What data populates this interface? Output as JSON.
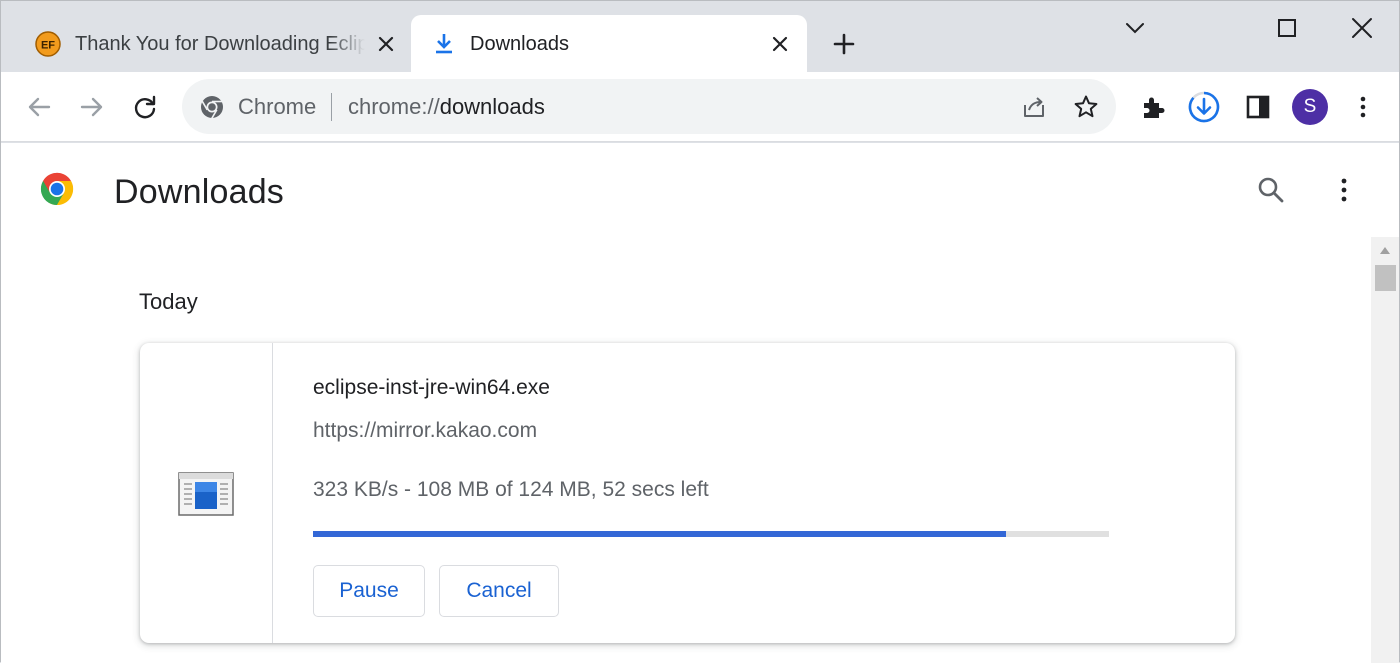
{
  "tabs": [
    {
      "title": "Thank You for Downloading Eclipse",
      "favicon_text": "EF",
      "active": false
    },
    {
      "title": "Downloads",
      "active": true
    }
  ],
  "omnibox": {
    "chip": "Chrome",
    "url_scheme": "chrome://",
    "url_host": "downloads"
  },
  "avatar": {
    "initial": "S"
  },
  "page": {
    "title": "Downloads",
    "section_date": "Today"
  },
  "download": {
    "file_name": "eclipse-inst-jre-win64.exe",
    "source_url": "https://mirror.kakao.com",
    "status": "323 KB/s - 108 MB of 124 MB, 52 secs left",
    "progress_fraction": 0.871,
    "pause_label": "Pause",
    "cancel_label": "Cancel"
  },
  "colors": {
    "accent": "#1a73e8",
    "avatar": "#4d2fa5",
    "progress_fill": "#3367d6",
    "progress_track": "#e0e0e0"
  },
  "icons": {
    "back": "arrow-left-icon",
    "forward": "arrow-right-icon",
    "reload": "reload-icon",
    "share": "share-icon",
    "bookmark": "star-icon",
    "extensions": "puzzle-icon",
    "downloads": "download-progress-icon",
    "side_panel": "side-panel-icon",
    "menu": "kebab-menu-icon",
    "search": "search-icon"
  }
}
